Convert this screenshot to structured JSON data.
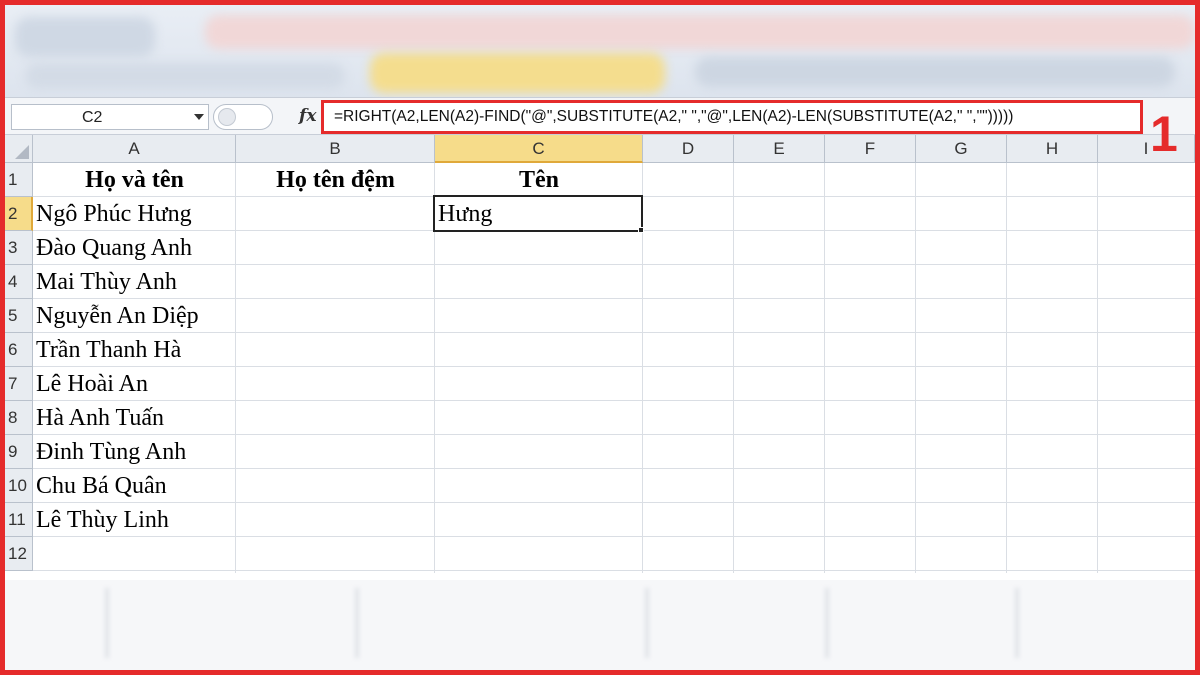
{
  "formula_bar": {
    "name_box": "C2",
    "fx_label": "fx",
    "formula": "=RIGHT(A2,LEN(A2)-FIND(\"@\",SUBSTITUTE(A2,\" \",\"@\",LEN(A2)-LEN(SUBSTITUTE(A2,\" \",\"\")))))"
  },
  "callout_number": "1",
  "columns": [
    "A",
    "B",
    "C",
    "D",
    "E",
    "F",
    "G",
    "H",
    "I"
  ],
  "rows": [
    "1",
    "2",
    "3",
    "4",
    "5",
    "6",
    "7",
    "8",
    "9",
    "10",
    "11",
    "12"
  ],
  "selected_column": "C",
  "selected_row": "2",
  "headers": {
    "a1": "Họ và tên",
    "b1": "Họ tên đệm",
    "c1": "Tên"
  },
  "names": [
    "Ngô Phúc Hưng",
    "Đào Quang Anh",
    "Mai Thùy Anh",
    "Nguyễn An Diệp",
    "Trần Thanh Hà",
    "Lê Hoài An",
    "Hà Anh Tuấn",
    "Đinh Tùng Anh",
    "Chu Bá Quân",
    "Lê Thùy Linh"
  ],
  "c2_value": "Hưng",
  "colors": {
    "highlight_red": "#e52b2b",
    "selected_header": "#f6dc8a"
  }
}
